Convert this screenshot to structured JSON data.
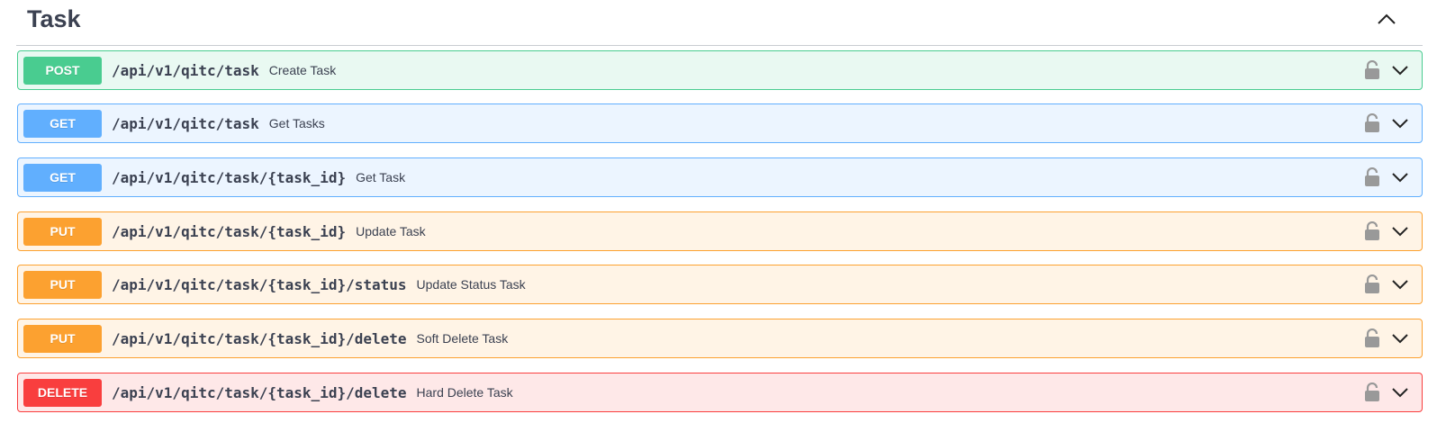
{
  "section": {
    "title": "Task",
    "collapse_icon": "chevron-up-icon"
  },
  "colors": {
    "post": "#49cc90",
    "get": "#61affe",
    "put": "#fca130",
    "delete": "#f93e3e",
    "text": "#3b4151"
  },
  "operations": [
    {
      "method": "POST",
      "path": "/api/v1/qitc/task",
      "summary": "Create Task",
      "lock_icon": "unlocked-padlock-icon",
      "expand_icon": "chevron-down-icon"
    },
    {
      "method": "GET",
      "path": "/api/v1/qitc/task",
      "summary": "Get Tasks",
      "lock_icon": "unlocked-padlock-icon",
      "expand_icon": "chevron-down-icon"
    },
    {
      "method": "GET",
      "path": "/api/v1/qitc/task/{task_id}",
      "summary": "Get Task",
      "lock_icon": "unlocked-padlock-icon",
      "expand_icon": "chevron-down-icon"
    },
    {
      "method": "PUT",
      "path": "/api/v1/qitc/task/{task_id}",
      "summary": "Update Task",
      "lock_icon": "unlocked-padlock-icon",
      "expand_icon": "chevron-down-icon"
    },
    {
      "method": "PUT",
      "path": "/api/v1/qitc/task/{task_id}/status",
      "summary": "Update Status Task",
      "lock_icon": "unlocked-padlock-icon",
      "expand_icon": "chevron-down-icon"
    },
    {
      "method": "PUT",
      "path": "/api/v1/qitc/task/{task_id}/delete",
      "summary": "Soft Delete Task",
      "lock_icon": "unlocked-padlock-icon",
      "expand_icon": "chevron-down-icon"
    },
    {
      "method": "DELETE",
      "path": "/api/v1/qitc/task/{task_id}/delete",
      "summary": "Hard Delete Task",
      "lock_icon": "unlocked-padlock-icon",
      "expand_icon": "chevron-down-icon"
    }
  ]
}
